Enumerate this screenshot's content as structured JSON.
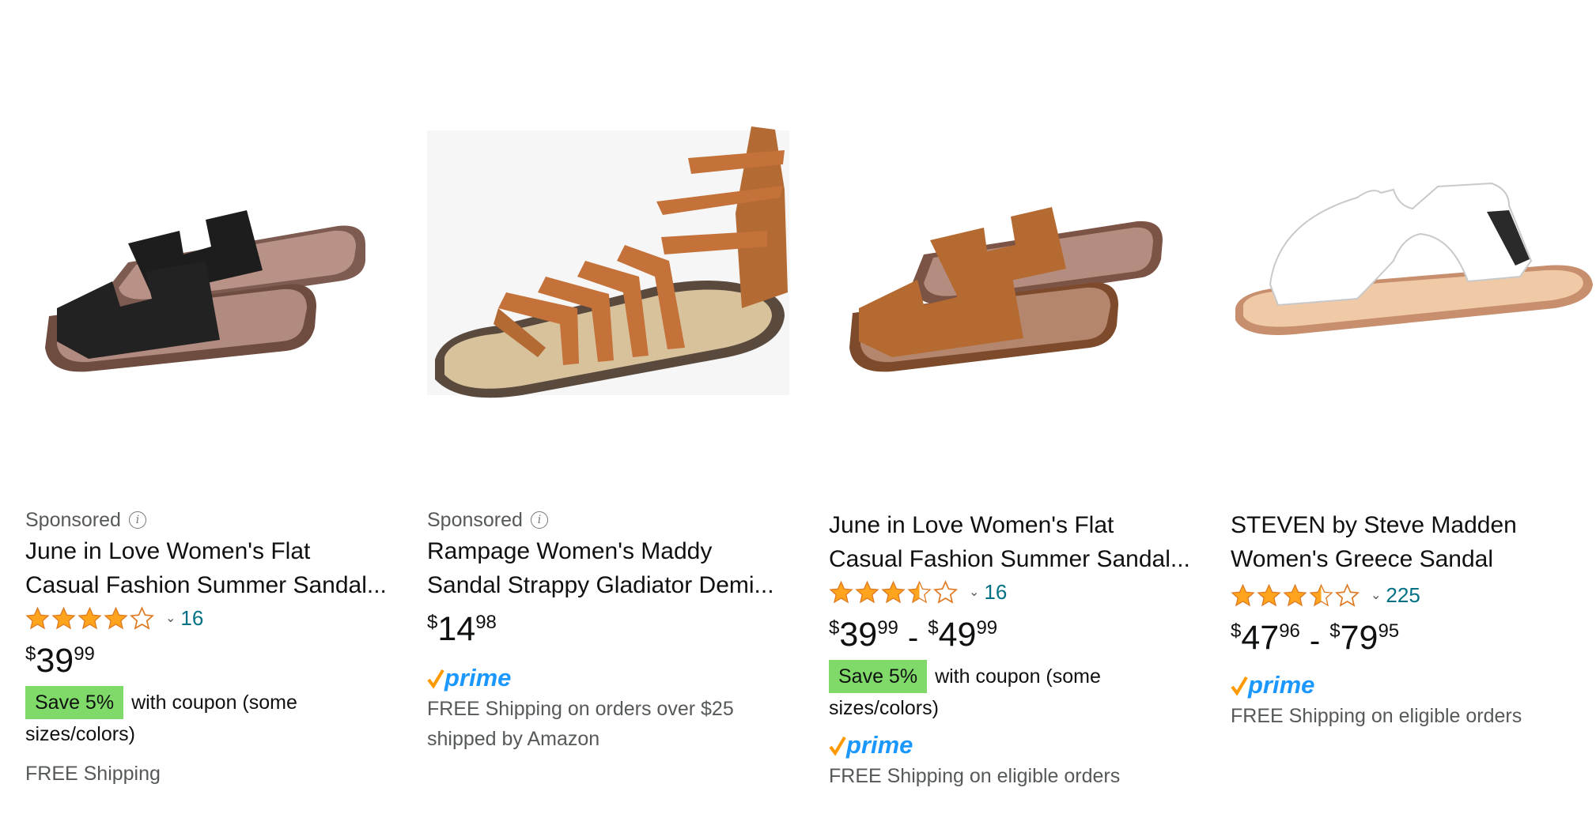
{
  "products": [
    {
      "sponsored": "Sponsored",
      "title_line1": "June in Love Women's Flat",
      "title_line2": "Casual Fashion Summer Sandal...",
      "review_count": "16",
      "stars": 4,
      "price": {
        "symbol": "$",
        "whole": "39",
        "fraction": "99"
      },
      "save_badge": "Save 5%",
      "coupon_text": "with coupon (some",
      "coupon_text2": "sizes/colors)",
      "shipping": "FREE Shipping",
      "image_icon": "sandal-black-h-slide"
    },
    {
      "sponsored": "Sponsored",
      "title_line1": "Rampage Women's Maddy",
      "title_line2": "Sandal Strappy Gladiator Demi...",
      "price": {
        "symbol": "$",
        "whole": "14",
        "fraction": "98"
      },
      "prime": "prime",
      "shipping": "FREE Shipping on orders over $25",
      "shipping2": "shipped by Amazon",
      "image_icon": "sandal-tan-gladiator"
    },
    {
      "title_line1": "June in Love Women's Flat",
      "title_line2": "Casual Fashion Summer Sandal...",
      "review_count": "16",
      "stars": 3.5,
      "price": {
        "symbol": "$",
        "whole": "39",
        "fraction": "99"
      },
      "price_high": {
        "symbol": "$",
        "whole": "49",
        "fraction": "99"
      },
      "save_badge": "Save 5%",
      "coupon_text": "with coupon (some",
      "coupon_text2": "sizes/colors)",
      "prime": "prime",
      "shipping": "FREE Shipping on eligible orders",
      "image_icon": "sandal-tan-h-slide"
    },
    {
      "title_line1": "STEVEN by Steve Madden",
      "title_line2": "Women's Greece Sandal",
      "review_count": "225",
      "stars": 3.5,
      "price": {
        "symbol": "$",
        "whole": "47",
        "fraction": "96"
      },
      "price_high": {
        "symbol": "$",
        "whole": "79",
        "fraction": "95"
      },
      "prime": "prime",
      "shipping": "FREE Shipping on eligible orders",
      "image_icon": "sandal-white-slide"
    }
  ],
  "colors": {
    "star": "#ffa41c",
    "link": "#007185",
    "save_badge": "#7fda69",
    "prime_blue": "#1a98ff",
    "prime_check": "#ff9900",
    "muted": "#565959"
  }
}
